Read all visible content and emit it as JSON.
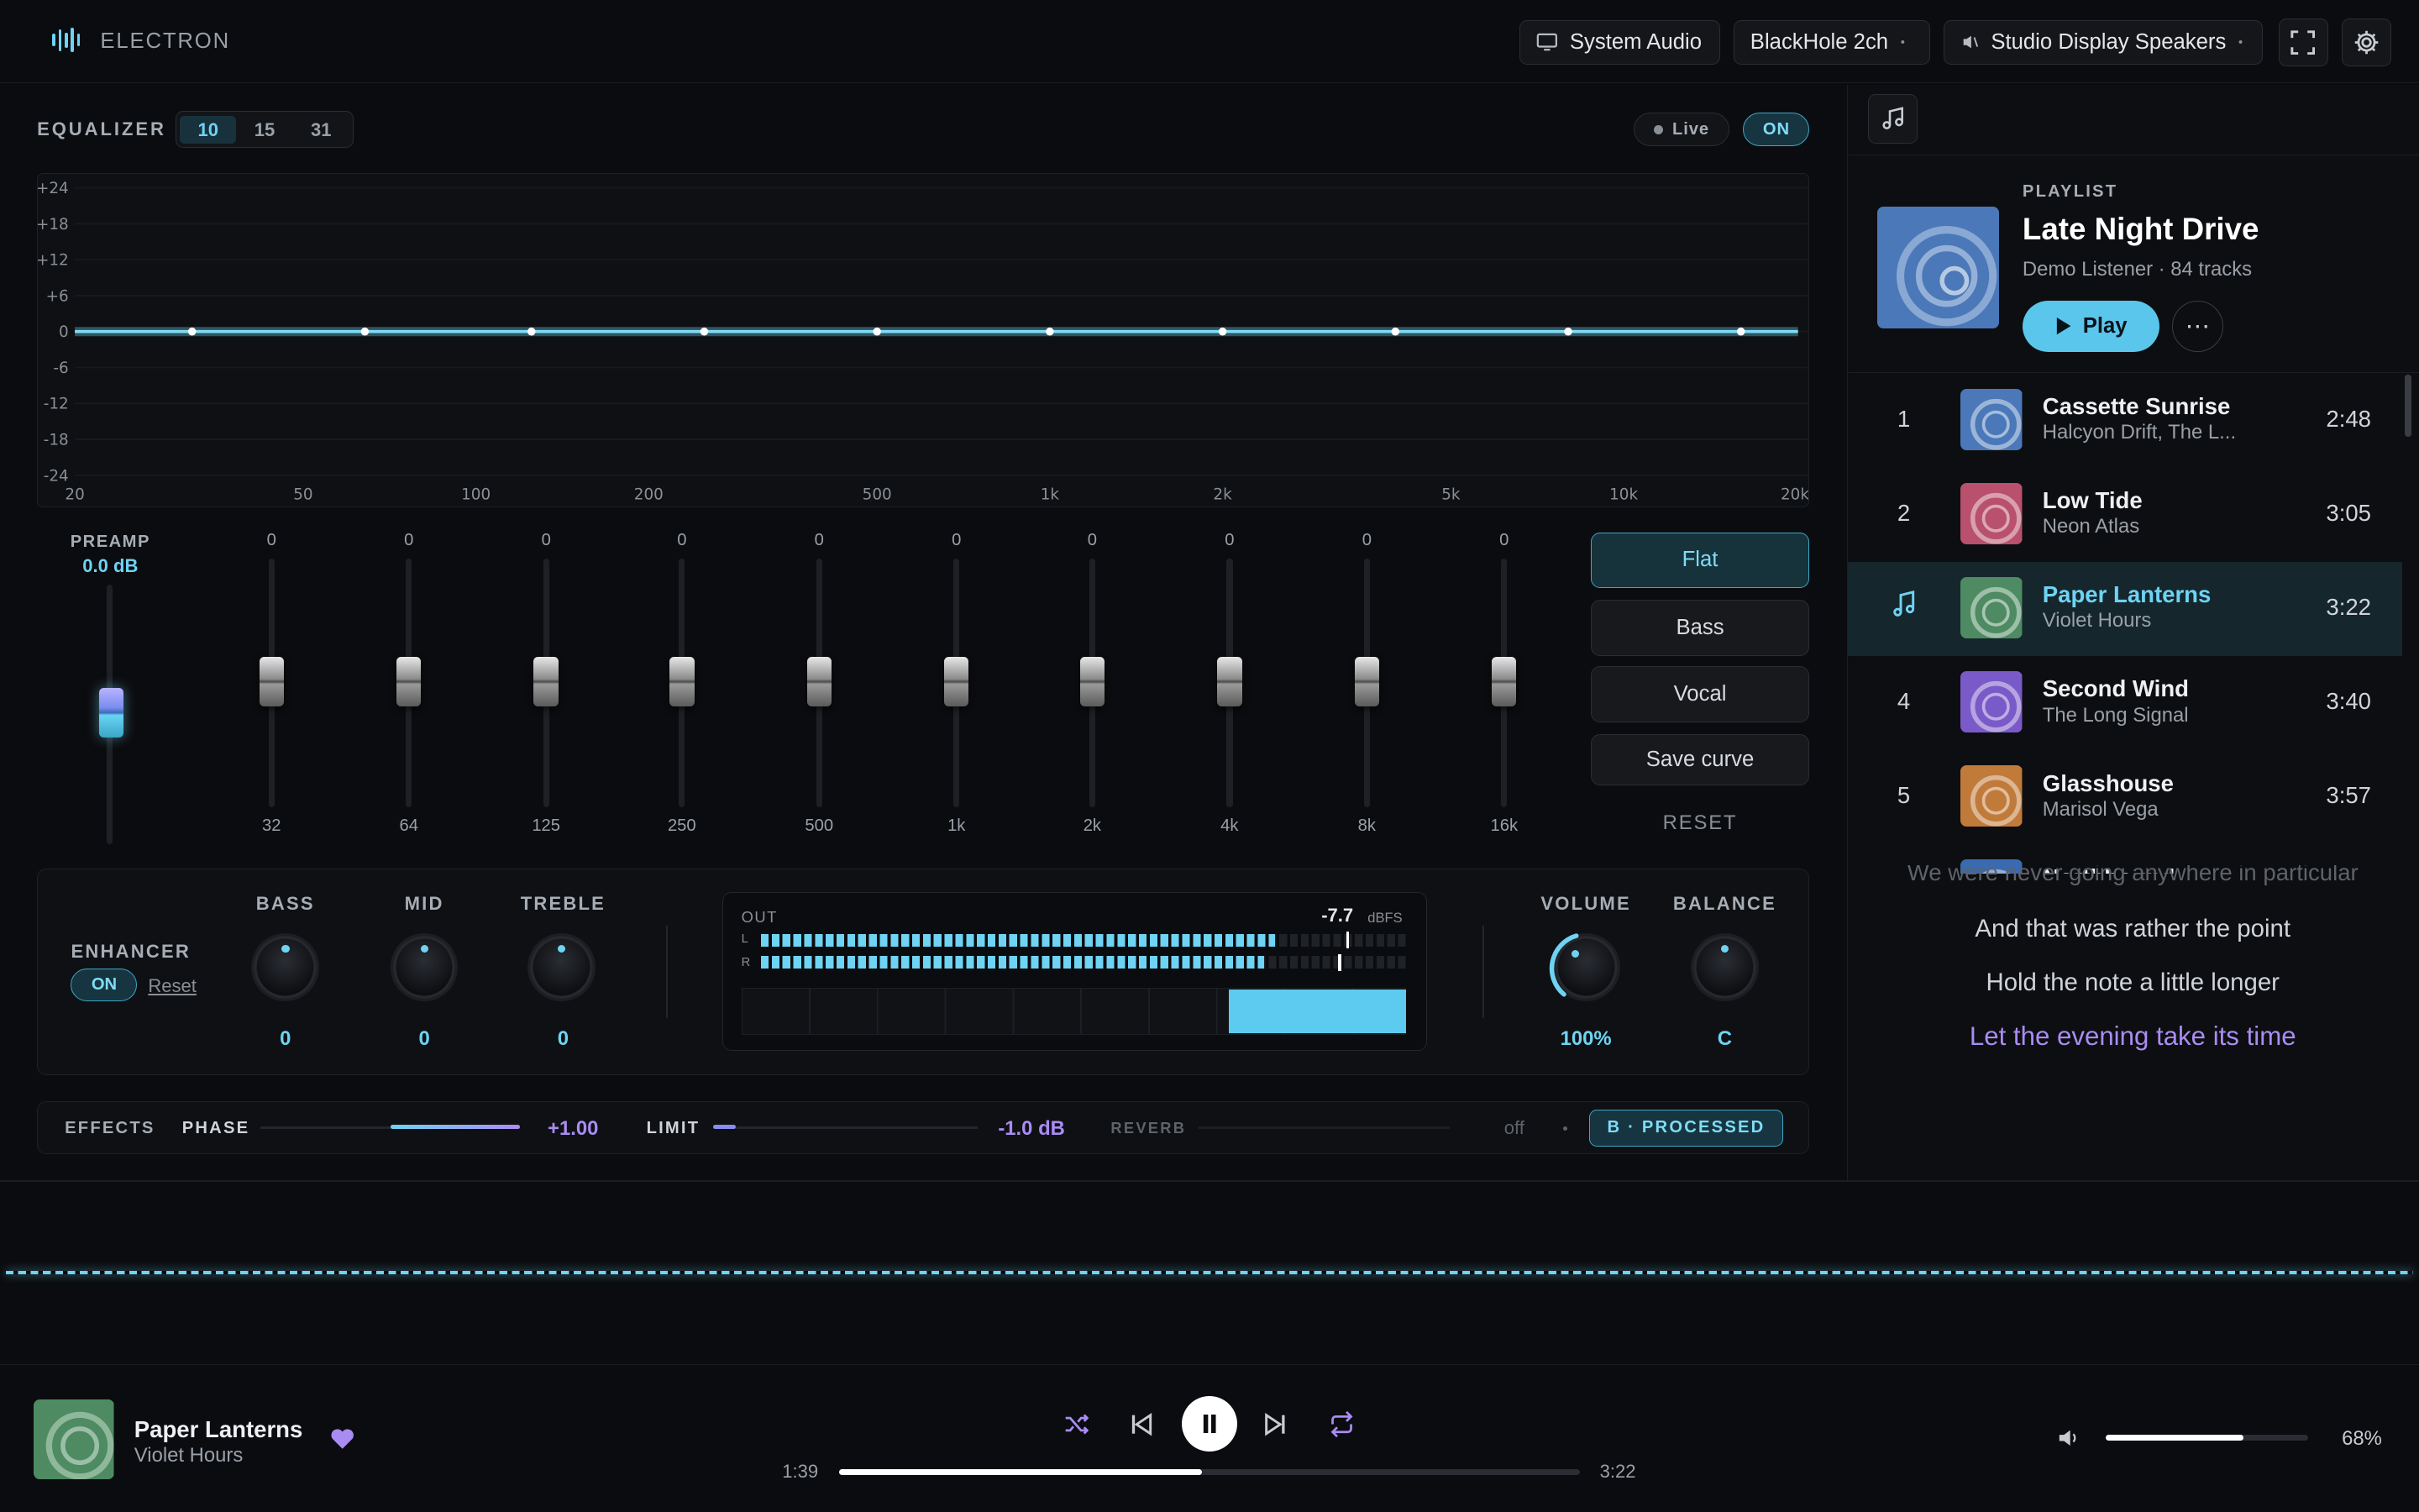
{
  "app": {
    "brand": "ELECTRON"
  },
  "devices": {
    "source": "System Audio",
    "loopback": "BlackHole 2ch",
    "output": "Studio Display Speakers"
  },
  "equalizer": {
    "title": "EQUALIZER",
    "band_modes": [
      "10",
      "15",
      "31"
    ],
    "active_mode": "10",
    "live_label": "Live",
    "on_label": "ON",
    "db_ticks": [
      "+24",
      "+18",
      "+12",
      "+6",
      "0",
      "-6",
      "-12",
      "-18",
      "-24"
    ],
    "freq_ticks": [
      "20",
      "50",
      "100",
      "200",
      "500",
      "1k",
      "2k",
      "5k",
      "10k",
      "20k"
    ],
    "preamp_label": "PREAMP",
    "preamp_value": "0.0 dB",
    "bands": [
      {
        "freq": "32",
        "gain": "0"
      },
      {
        "freq": "64",
        "gain": "0"
      },
      {
        "freq": "125",
        "gain": "0"
      },
      {
        "freq": "250",
        "gain": "0"
      },
      {
        "freq": "500",
        "gain": "0"
      },
      {
        "freq": "1k",
        "gain": "0"
      },
      {
        "freq": "2k",
        "gain": "0"
      },
      {
        "freq": "4k",
        "gain": "0"
      },
      {
        "freq": "8k",
        "gain": "0"
      },
      {
        "freq": "16k",
        "gain": "0"
      }
    ],
    "presets": [
      "Flat",
      "Bass",
      "Vocal"
    ],
    "save_label": "Save curve",
    "reset_label": "RESET"
  },
  "enhancer": {
    "label": "ENHANCER",
    "on_label": "ON",
    "reset_label": "Reset",
    "knobs": [
      {
        "label": "BASS",
        "value": "0"
      },
      {
        "label": "MID",
        "value": "0"
      },
      {
        "label": "TREBLE",
        "value": "0"
      }
    ],
    "meter": {
      "out_label": "OUT",
      "level": "-7.7",
      "unit": "dBFS",
      "l": "L",
      "r": "R"
    },
    "volume": {
      "label": "VOLUME",
      "value": "100%"
    },
    "balance": {
      "label": "BALANCE",
      "value": "C"
    }
  },
  "effects": {
    "label": "EFFECTS",
    "phase": {
      "label": "PHASE",
      "value": "+1.00"
    },
    "limit": {
      "label": "LIMIT",
      "value": "-1.0 dB"
    },
    "reverb": {
      "label": "REVERB",
      "value": "off"
    },
    "ab_label": "B · PROCESSED"
  },
  "playlist": {
    "kicker": "PLAYLIST",
    "title": "Late Night Drive",
    "subtitle": "Demo Listener · 84 tracks",
    "play_label": "Play",
    "tracks": [
      {
        "n": "1",
        "title": "Cassette Sunrise",
        "artist": "Halcyon Drift, The L...",
        "dur": "2:48",
        "color": "#4a78b8"
      },
      {
        "n": "2",
        "title": "Low Tide",
        "artist": "Neon Atlas",
        "dur": "3:05",
        "color": "#b8506e"
      },
      {
        "n": "",
        "title": "Paper Lanterns",
        "artist": "Violet Hours",
        "dur": "3:22",
        "color": "#4e8a62"
      },
      {
        "n": "4",
        "title": "Second Wind",
        "artist": "The Long Signal",
        "dur": "3:40",
        "color": "#7a5ac8"
      },
      {
        "n": "5",
        "title": "Glasshouse",
        "artist": "Marisol Vega",
        "dur": "3:57",
        "color": "#c07a3a"
      },
      {
        "n": "6",
        "title": "Northbound",
        "artist": "",
        "dur": "",
        "color": "#3a6ab0"
      }
    ],
    "lyrics": [
      "We were never going anywhere in particular",
      "And that was rather the point",
      "Hold the note a little longer",
      "Let the evening take its time"
    ]
  },
  "now_playing": {
    "title": "Paper Lanterns",
    "artist": "Violet Hours",
    "elapsed": "1:39",
    "total": "3:22",
    "progress": 0.49,
    "volume": "68%",
    "volume_level": 0.68
  },
  "colors": {
    "accent": "#6fd3f3",
    "accent2": "#a98cf3",
    "bg": "#0b0c0f"
  }
}
